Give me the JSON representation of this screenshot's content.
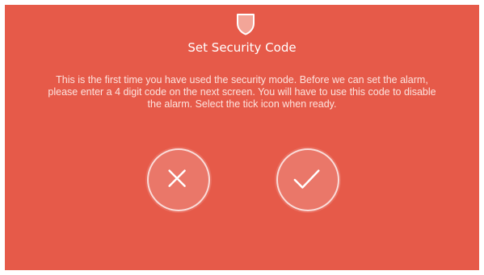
{
  "dialog": {
    "title": "Set Security Code",
    "message": "This is the first time you have used the security mode. Before we can set the alarm, please enter a 4 digit code on the next screen. You will have to use this code to disable the alarm. Select the tick icon when ready."
  },
  "icons": {
    "header": "shield-icon",
    "cancel": "cross-icon",
    "confirm": "tick-icon"
  },
  "colors": {
    "background": "#e65a49",
    "foreground": "#ffffff",
    "shield_fill": "#f3a598"
  }
}
